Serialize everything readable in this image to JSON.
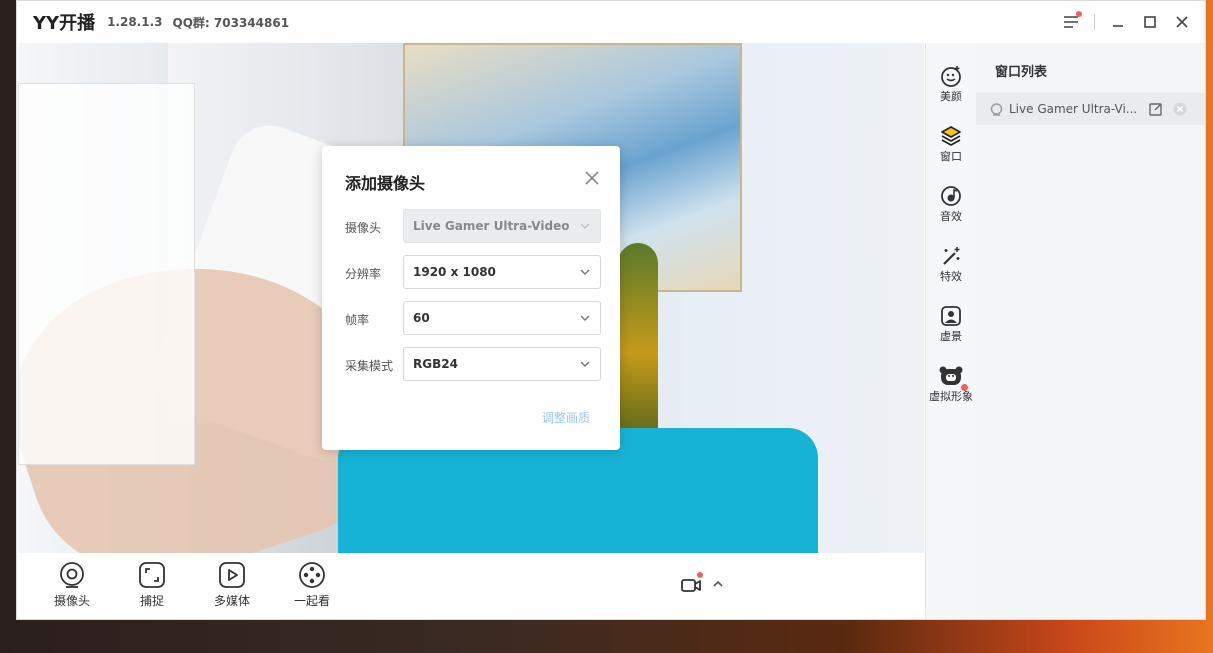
{
  "titlebar": {
    "logo": "YY开播",
    "version": "1.28.1.3",
    "qq": "QQ群: 703344861"
  },
  "bottombar": {
    "items": [
      {
        "label": "摄像头",
        "icon": "camera-icon"
      },
      {
        "label": "捕捉",
        "icon": "capture-icon"
      },
      {
        "label": "多媒体",
        "icon": "media-play-icon"
      },
      {
        "label": "一起看",
        "icon": "watch-together-icon"
      }
    ]
  },
  "iconcol": {
    "items": [
      {
        "label": "美颜",
        "icon": "beauty-face-icon"
      },
      {
        "label": "窗口",
        "icon": "layers-icon",
        "active": true
      },
      {
        "label": "音效",
        "icon": "audio-effect-icon"
      },
      {
        "label": "特效",
        "icon": "magic-wand-icon"
      },
      {
        "label": "虚景",
        "icon": "virtual-background-icon"
      },
      {
        "label": "虚拟形象",
        "icon": "avatar-bear-icon",
        "badge": true
      }
    ]
  },
  "panel": {
    "title": "窗口列表",
    "rows": [
      {
        "text": "Live Gamer Ultra-Vi...",
        "icon": "webcam-source-icon"
      }
    ]
  },
  "dialog": {
    "title": "添加摄像头",
    "fields": [
      {
        "label": "摄像头",
        "value": "Live Gamer Ultra-Video",
        "disabled": true
      },
      {
        "label": "分辨率",
        "value": "1920 x 1080",
        "disabled": false
      },
      {
        "label": "帧率",
        "value": "60",
        "disabled": false
      },
      {
        "label": "采集模式",
        "value": "RGB24",
        "disabled": false
      }
    ],
    "link": "调整画质"
  },
  "colors": {
    "accent_red": "#f06060",
    "link_blue": "#9cc7ea",
    "layer_active": "#f5c518"
  }
}
